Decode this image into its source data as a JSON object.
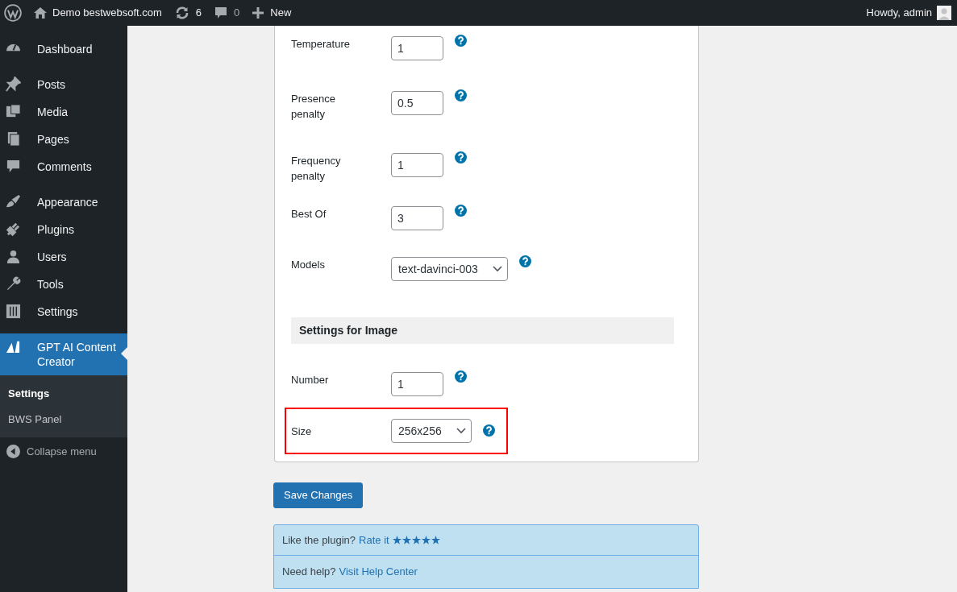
{
  "admin_bar": {
    "site": "Demo bestwebsoft.com",
    "updates": "6",
    "comments": "0",
    "new": "New",
    "greeting": "Howdy, admin"
  },
  "sidebar": {
    "items": [
      {
        "label": "Dashboard",
        "selected": false
      },
      {
        "label": "Posts",
        "selected": false
      },
      {
        "label": "Media",
        "selected": false
      },
      {
        "label": "Pages",
        "selected": false
      },
      {
        "label": "Comments",
        "selected": false
      },
      {
        "label": "Appearance",
        "selected": false
      },
      {
        "label": "Plugins",
        "selected": false
      },
      {
        "label": "Users",
        "selected": false
      },
      {
        "label": "Tools",
        "selected": false
      },
      {
        "label": "Settings",
        "selected": false
      },
      {
        "label": "GPT AI Content Creator",
        "selected": true,
        "children": [
          {
            "label": "Settings",
            "selected": true
          },
          {
            "label": "BWS Panel",
            "selected": false
          }
        ]
      }
    ],
    "collapse": "Collapse menu"
  },
  "form": {
    "rows": [
      {
        "kind": "number",
        "label": "Temperature",
        "value": "1",
        "highlighted": false
      },
      {
        "kind": "number",
        "label": "Presence penalty",
        "value": "0.5",
        "highlighted": false
      },
      {
        "kind": "number",
        "label": "Frequency penalty",
        "value": "1",
        "highlighted": false
      },
      {
        "kind": "number",
        "label": "Best Of",
        "value": "3",
        "highlighted": false
      },
      {
        "kind": "select",
        "label": "Models",
        "value": "text-davinci-003",
        "highlighted": false
      },
      {
        "kind": "heading",
        "label": "Settings for Image"
      },
      {
        "kind": "number",
        "label": "Number",
        "value": "1",
        "highlighted": false
      },
      {
        "kind": "select",
        "label": "Size",
        "value": "256x256",
        "highlighted": true
      }
    ]
  },
  "save_button": "Save Changes",
  "info": {
    "rate_text": "Like the plugin?",
    "rate_link": "Rate it",
    "stars": 5,
    "help_text": "Need help?",
    "help_link": "Visit Help Center"
  }
}
